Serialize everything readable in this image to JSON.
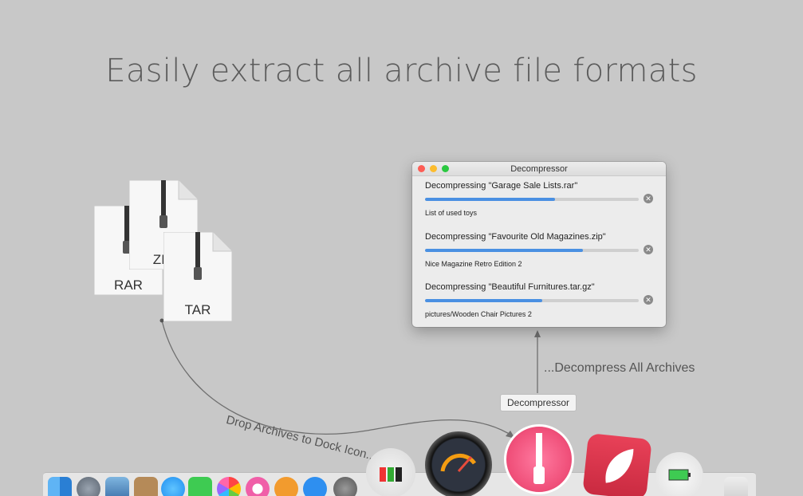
{
  "headline": "Easily extract all archive file formats",
  "archives": [
    {
      "label": "RAR"
    },
    {
      "label": "ZIP"
    },
    {
      "label": "TAR"
    }
  ],
  "annotations": {
    "drop": "Drop Archives to Dock Icon...",
    "decompress": "...Decompress All Archives"
  },
  "window": {
    "title": "Decompressor",
    "tasks": [
      {
        "title": "Decompressing \"Garage Sale Lists.rar\"",
        "progress": 0.61,
        "subtitle": "List of used toys"
      },
      {
        "title": "Decompressing \"Favourite Old Magazines.zip\"",
        "progress": 0.74,
        "subtitle": "Nice Magazine Retro Edition 2"
      },
      {
        "title": "Decompressing \"Beautiful Furnitures.tar.gz\"",
        "progress": 0.55,
        "subtitle": "pictures/Wooden Chair Pictures 2"
      }
    ],
    "cancel_glyph": "✕"
  },
  "dock": {
    "tooltip": "Decompressor",
    "icons": [
      "finder-icon",
      "launchpad-icon",
      "preview-icon",
      "contacts-icon",
      "messages-icon",
      "facetime-icon",
      "photos-icon",
      "itunes-icon",
      "ibooks-icon",
      "app-store-icon",
      "system-preferences-icon",
      "memory-app-icon",
      "disk-diag-icon",
      "decompressor-icon",
      "leaf-app-icon",
      "battery-app-icon",
      "trash-icon"
    ]
  },
  "colors": {
    "background": "#c8c8c8",
    "progress": "#4a90e2",
    "decompressor_pink": "#f0507a",
    "leaf_red": "#d6364b"
  }
}
